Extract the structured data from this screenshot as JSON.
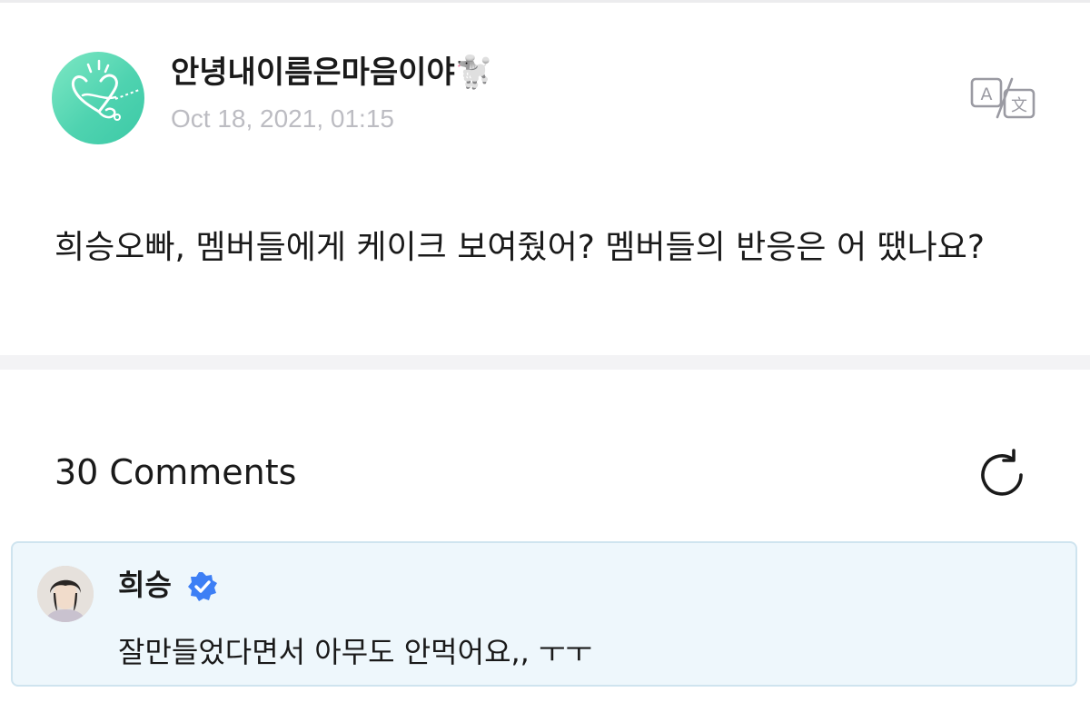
{
  "post": {
    "author_name": "안녕내이름은마음이야🐩",
    "date": "Oct 18, 2021, 01:15",
    "text": "희승오빠, 멤버들에게 케이크 보여줬어?  멤버들의 반응은 어 땠나요?",
    "avatar_icon": "heart-scribble-avatar",
    "avatar_color": "#4fd3b0"
  },
  "toolbar": {
    "translate_icon": "translate-icon"
  },
  "comments": {
    "title": "30 Comments",
    "refresh_icon": "refresh-icon",
    "items": [
      {
        "author": "희승",
        "verified": true,
        "verified_color": "#3d7ff5",
        "text": "잘만들었다면서 아무도 안먹어요,, ㅜㅜ",
        "highlight_background": "#eef7fc"
      }
    ]
  }
}
